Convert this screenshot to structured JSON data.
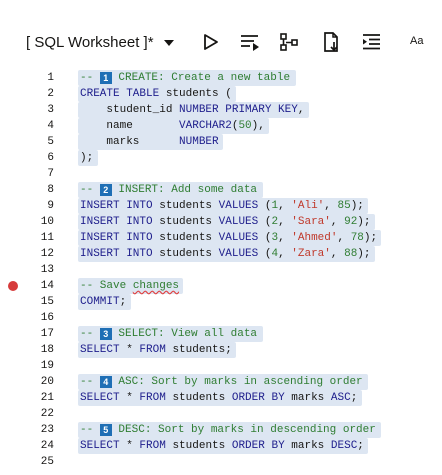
{
  "toolbar": {
    "title": "[ SQL Worksheet ]*",
    "font_label": "Aa",
    "icons": [
      "chevron-down-icon",
      "run-icon",
      "run-script-icon",
      "explain-plan-icon",
      "download-icon",
      "format-icon"
    ]
  },
  "editor": {
    "breakpoint_line": 14,
    "lines": [
      {
        "n": "1",
        "segs": [
          {
            "t": "-- ",
            "c": "com"
          },
          {
            "badge": "1"
          },
          {
            "t": " CREATE: Create a new table",
            "c": "com"
          }
        ]
      },
      {
        "n": "2",
        "segs": [
          {
            "t": "CREATE TABLE ",
            "c": "kw"
          },
          {
            "t": "students",
            "c": "id"
          },
          {
            "t": " (",
            "c": "id"
          }
        ]
      },
      {
        "n": "3",
        "segs": [
          {
            "t": "    student_id ",
            "c": "id"
          },
          {
            "t": "NUMBER PRIMARY KEY",
            "c": "kw"
          },
          {
            "t": ",",
            "c": "id"
          }
        ]
      },
      {
        "n": "4",
        "segs": [
          {
            "t": "    name       ",
            "c": "id"
          },
          {
            "t": "VARCHAR2",
            "c": "kw"
          },
          {
            "t": "(",
            "c": "id"
          },
          {
            "t": "50",
            "c": "num"
          },
          {
            "t": "),",
            "c": "id"
          }
        ]
      },
      {
        "n": "5",
        "segs": [
          {
            "t": "    marks      ",
            "c": "id"
          },
          {
            "t": "NUMBER",
            "c": "kw"
          }
        ]
      },
      {
        "n": "6",
        "segs": [
          {
            "t": ");",
            "c": "id"
          }
        ]
      },
      {
        "n": "7",
        "segs": []
      },
      {
        "n": "8",
        "segs": [
          {
            "t": "-- ",
            "c": "com"
          },
          {
            "badge": "2"
          },
          {
            "t": " INSERT: Add some data",
            "c": "com"
          }
        ]
      },
      {
        "n": "9",
        "segs": [
          {
            "t": "INSERT INTO ",
            "c": "kw"
          },
          {
            "t": "students ",
            "c": "id"
          },
          {
            "t": "VALUES ",
            "c": "kw"
          },
          {
            "t": "(",
            "c": "id"
          },
          {
            "t": "1",
            "c": "num"
          },
          {
            "t": ", ",
            "c": "id"
          },
          {
            "t": "'Ali'",
            "c": "str"
          },
          {
            "t": ", ",
            "c": "id"
          },
          {
            "t": "85",
            "c": "num"
          },
          {
            "t": ");",
            "c": "id"
          }
        ]
      },
      {
        "n": "10",
        "segs": [
          {
            "t": "INSERT INTO ",
            "c": "kw"
          },
          {
            "t": "students ",
            "c": "id"
          },
          {
            "t": "VALUES ",
            "c": "kw"
          },
          {
            "t": "(",
            "c": "id"
          },
          {
            "t": "2",
            "c": "num"
          },
          {
            "t": ", ",
            "c": "id"
          },
          {
            "t": "'Sara'",
            "c": "str"
          },
          {
            "t": ", ",
            "c": "id"
          },
          {
            "t": "92",
            "c": "num"
          },
          {
            "t": ");",
            "c": "id"
          }
        ]
      },
      {
        "n": "11",
        "segs": [
          {
            "t": "INSERT INTO ",
            "c": "kw"
          },
          {
            "t": "students ",
            "c": "id"
          },
          {
            "t": "VALUES ",
            "c": "kw"
          },
          {
            "t": "(",
            "c": "id"
          },
          {
            "t": "3",
            "c": "num"
          },
          {
            "t": ", ",
            "c": "id"
          },
          {
            "t": "'Ahmed'",
            "c": "str"
          },
          {
            "t": ", ",
            "c": "id"
          },
          {
            "t": "78",
            "c": "num"
          },
          {
            "t": ");",
            "c": "id"
          }
        ]
      },
      {
        "n": "12",
        "segs": [
          {
            "t": "INSERT INTO ",
            "c": "kw"
          },
          {
            "t": "students ",
            "c": "id"
          },
          {
            "t": "VALUES ",
            "c": "kw"
          },
          {
            "t": "(",
            "c": "id"
          },
          {
            "t": "4",
            "c": "num"
          },
          {
            "t": ", ",
            "c": "id"
          },
          {
            "t": "'Zara'",
            "c": "str"
          },
          {
            "t": ", ",
            "c": "id"
          },
          {
            "t": "88",
            "c": "num"
          },
          {
            "t": ");",
            "c": "id"
          }
        ]
      },
      {
        "n": "13",
        "segs": []
      },
      {
        "n": "14",
        "segs": [
          {
            "t": "-- Save ",
            "c": "com"
          },
          {
            "t": "changes",
            "c": "com",
            "squiggle": true
          }
        ]
      },
      {
        "n": "15",
        "segs": [
          {
            "t": "COMMIT",
            "c": "kw"
          },
          {
            "t": ";",
            "c": "id"
          }
        ]
      },
      {
        "n": "16",
        "segs": []
      },
      {
        "n": "17",
        "segs": [
          {
            "t": "-- ",
            "c": "com"
          },
          {
            "badge": "3"
          },
          {
            "t": " SELECT: View all data",
            "c": "com"
          }
        ]
      },
      {
        "n": "18",
        "segs": [
          {
            "t": "SELECT ",
            "c": "kw"
          },
          {
            "t": "* ",
            "c": "id"
          },
          {
            "t": "FROM ",
            "c": "kw"
          },
          {
            "t": "students;",
            "c": "id"
          }
        ]
      },
      {
        "n": "19",
        "segs": []
      },
      {
        "n": "20",
        "segs": [
          {
            "t": "-- ",
            "c": "com"
          },
          {
            "badge": "4"
          },
          {
            "t": " ASC: Sort by marks in ascending order",
            "c": "com"
          }
        ]
      },
      {
        "n": "21",
        "segs": [
          {
            "t": "SELECT ",
            "c": "kw"
          },
          {
            "t": "* ",
            "c": "id"
          },
          {
            "t": "FROM ",
            "c": "kw"
          },
          {
            "t": "students ",
            "c": "id"
          },
          {
            "t": "ORDER BY ",
            "c": "kw"
          },
          {
            "t": "marks ",
            "c": "id"
          },
          {
            "t": "ASC",
            "c": "kw"
          },
          {
            "t": ";",
            "c": "id"
          }
        ]
      },
      {
        "n": "22",
        "segs": []
      },
      {
        "n": "23",
        "segs": [
          {
            "t": "-- ",
            "c": "com"
          },
          {
            "badge": "5"
          },
          {
            "t": " DESC: Sort by marks in descending order",
            "c": "com"
          }
        ]
      },
      {
        "n": "24",
        "segs": [
          {
            "t": "SELECT ",
            "c": "kw"
          },
          {
            "t": "* ",
            "c": "id"
          },
          {
            "t": "FROM ",
            "c": "kw"
          },
          {
            "t": "students ",
            "c": "id"
          },
          {
            "t": "ORDER BY ",
            "c": "kw"
          },
          {
            "t": "marks ",
            "c": "id"
          },
          {
            "t": "DESC",
            "c": "kw"
          },
          {
            "t": ";",
            "c": "id"
          }
        ]
      },
      {
        "n": "25",
        "segs": []
      }
    ]
  },
  "colors": {
    "selection": "#dde6f2",
    "keyword": "#1e1e8c",
    "comment": "#2f7d32",
    "string": "#c0392b",
    "badge": "#1f6fb5",
    "breakpoint": "#d63b3b"
  }
}
